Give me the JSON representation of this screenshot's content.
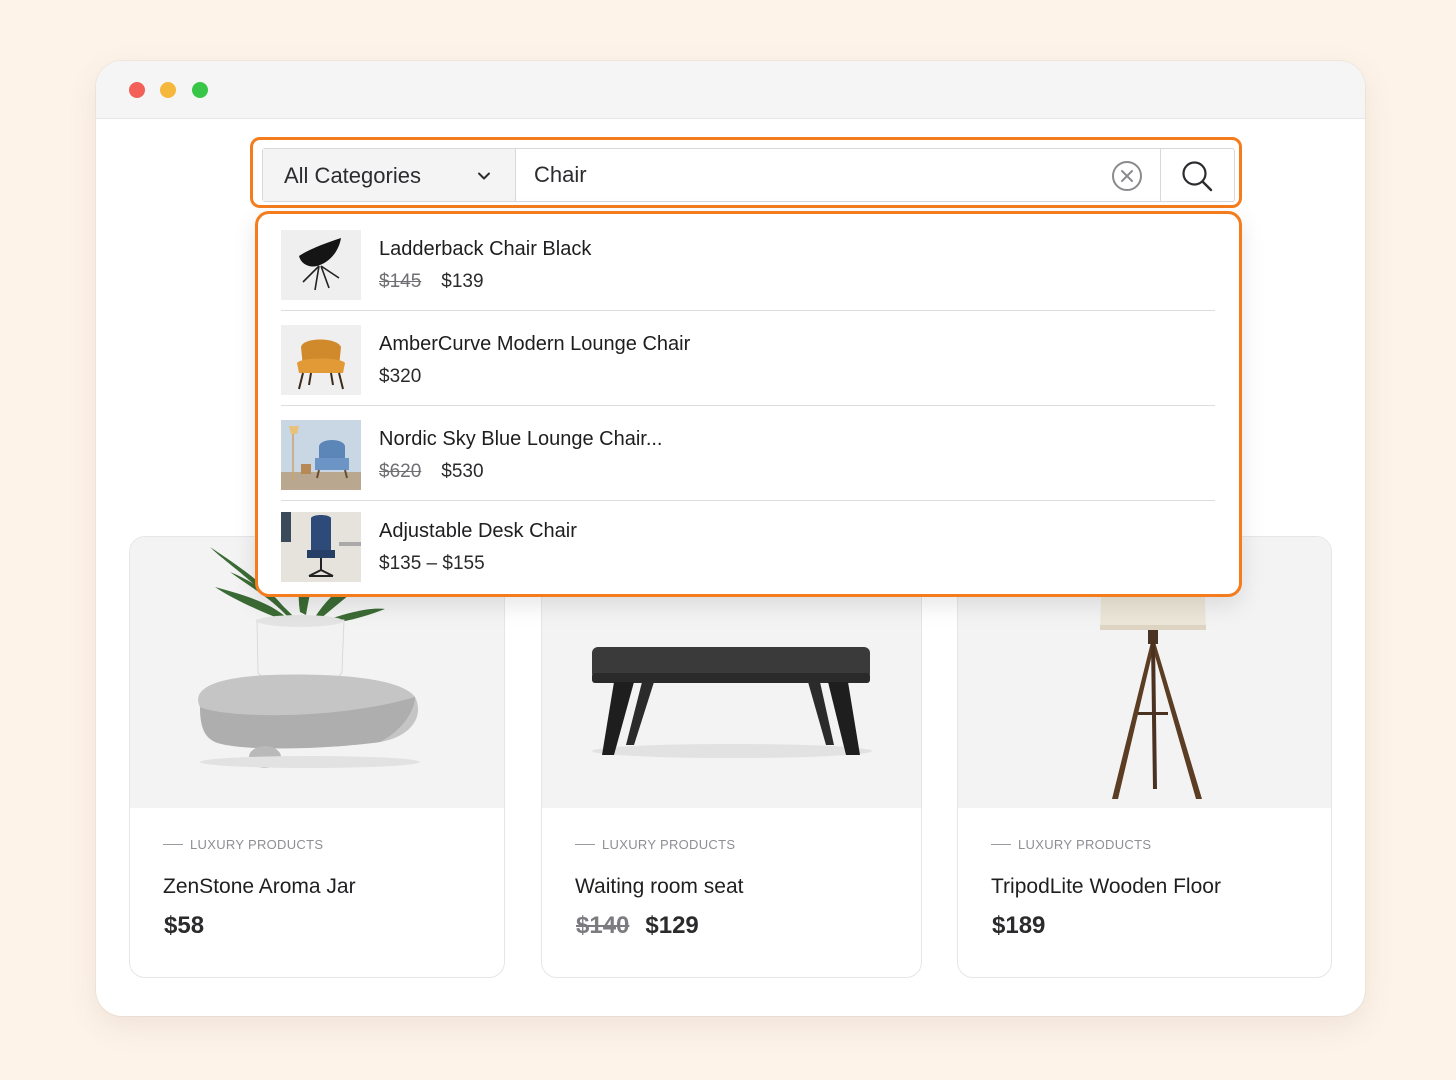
{
  "search": {
    "category": "All Categories",
    "query": "Chair"
  },
  "results": [
    {
      "title": "Ladderback Chair Black",
      "old_price": "$145",
      "price": "$139"
    },
    {
      "title": "AmberCurve Modern Lounge Chair",
      "old_price": "",
      "price": "$320"
    },
    {
      "title": "Nordic Sky Blue Lounge Chair...",
      "old_price": "$620",
      "price": "$530"
    },
    {
      "title": "Adjustable Desk Chair",
      "old_price": "",
      "price": "$135 – $155"
    }
  ],
  "products": [
    {
      "category": "LUXURY PRODUCTS",
      "title": "ZenStone Aroma Jar",
      "old_price": "",
      "price": "$58"
    },
    {
      "category": "LUXURY PRODUCTS",
      "title": "Waiting room seat",
      "old_price": "$140",
      "price": "$129"
    },
    {
      "category": "LUXURY PRODUCTS",
      "title": "TripodLite Wooden Floor",
      "old_price": "",
      "price": "$189"
    }
  ],
  "colors": {
    "accent": "#f47c1c",
    "background": "#fdf3e9",
    "window_close": "#f26058",
    "window_minimize": "#f6b73d",
    "window_zoom": "#39c648"
  },
  "icons": {
    "category_toggle": "chevron-down-icon",
    "clear": "clear-circle-icon",
    "search": "search-icon",
    "annotation": "arrow-icon"
  }
}
